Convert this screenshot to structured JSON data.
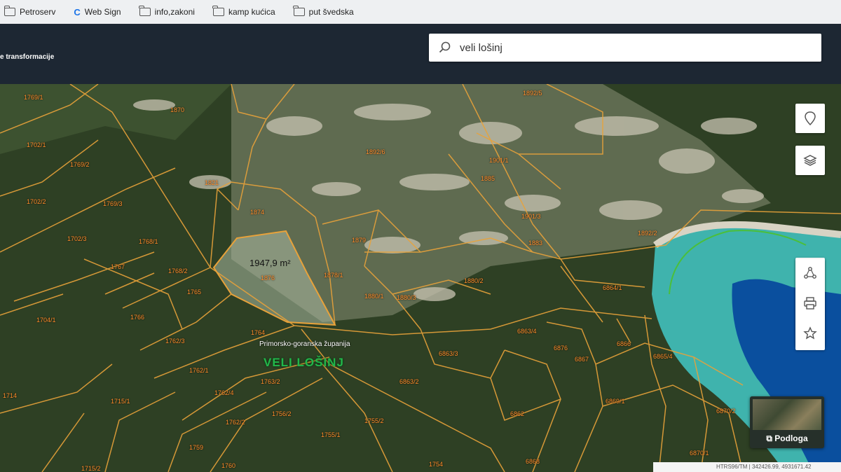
{
  "bookmarks": [
    {
      "label": "Petroserv",
      "icon": "folder-icon"
    },
    {
      "label": "Web Sign",
      "icon": "c-logo-icon"
    },
    {
      "label": "info,zakoni",
      "icon": "folder-icon"
    },
    {
      "label": "kamp kućica",
      "icon": "folder-icon"
    },
    {
      "label": "put švedska",
      "icon": "folder-icon"
    }
  ],
  "header": {
    "menu_text": "e transformacije"
  },
  "search": {
    "value": "veli lošinj",
    "icon": "search-icon"
  },
  "map": {
    "area_label": "1947,9 m²",
    "county_label": "Primorsko-goranska županija",
    "town_label": "VELI LOŠINJ",
    "parcels": [
      "1769/1",
      "1870",
      "1702/1",
      "1769/2",
      "1821",
      "1874",
      "1702/2",
      "1769/3",
      "1702/3",
      "1768/1",
      "1767",
      "1768/2",
      "1765",
      "1876",
      "1878/1",
      "1880/1",
      "1880/3",
      "1880/2",
      "1704/1",
      "1766",
      "1762/3",
      "1764",
      "1762/1",
      "1763/2",
      "1762/4",
      "1762/2",
      "1756/2",
      "1755/1",
      "1755/2",
      "1715/1",
      "1714",
      "1759",
      "1715/2",
      "1760",
      "1754",
      "1892/6",
      "1892/5",
      "1901/1",
      "1885",
      "1901/3",
      "1883",
      "1879",
      "6863/3",
      "6863/4",
      "6863/2",
      "6862",
      "6864/1",
      "6866",
      "6867",
      "6876",
      "6865/4",
      "6869/1",
      "6868",
      "6870/2",
      "6870/1",
      "1892/2"
    ],
    "basemap_label": "Podloga",
    "coords_text": "HTRS96/TM | 342426.99, 4931671.42"
  },
  "tools": {
    "location": "location-pin-icon",
    "layers": "layers-icon",
    "zoom_search": "zoom-pin-icon",
    "measure": "ruler-icon",
    "share": "share-icon",
    "print": "print-icon",
    "favorite": "star-icon",
    "basemap": "basemap-icon"
  }
}
